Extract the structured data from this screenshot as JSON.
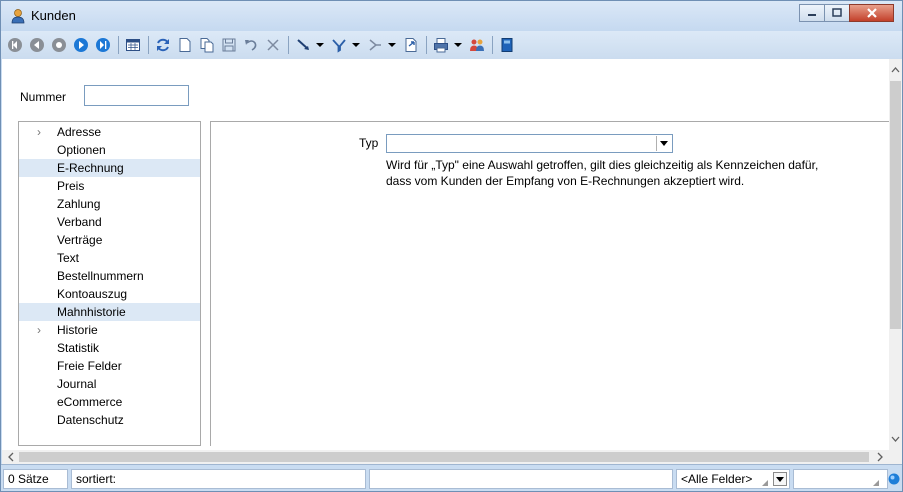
{
  "window": {
    "title": "Kunden"
  },
  "toolbar": {
    "icons": [
      "first-record-icon",
      "prev-page-icon",
      "prev-record-icon",
      "next-record-icon",
      "last-record-icon",
      "calendar-icon",
      "refresh-icon",
      "new-icon",
      "copy-icon",
      "save-icon",
      "undo-icon",
      "delete-icon",
      "tools-icon",
      "filter-icon",
      "sort-icon",
      "export-icon",
      "print-icon",
      "contacts-icon",
      "close-form-icon"
    ]
  },
  "header": {
    "nummer_label": "Nummer",
    "nummer_value": ""
  },
  "nav": {
    "items": [
      {
        "label": "Adresse",
        "expandable": true
      },
      {
        "label": "Optionen"
      },
      {
        "label": "E-Rechnung",
        "selected": true
      },
      {
        "label": "Preis"
      },
      {
        "label": "Zahlung"
      },
      {
        "label": "Verband"
      },
      {
        "label": "Verträge"
      },
      {
        "label": "Text"
      },
      {
        "label": "Bestellnummern"
      },
      {
        "label": "Kontoauszug"
      },
      {
        "label": "Mahnhistorie",
        "selected": true
      },
      {
        "label": "Historie",
        "expandable": true
      },
      {
        "label": "Statistik"
      },
      {
        "label": "Freie Felder"
      },
      {
        "label": "Journal"
      },
      {
        "label": "eCommerce"
      },
      {
        "label": "Datenschutz"
      }
    ]
  },
  "detail": {
    "typ_label": "Typ",
    "typ_value": "",
    "hint_line1": "Wird für „Typ\" eine Auswahl getroffen, gilt dies gleichzeitig als Kennzeichen dafür,",
    "hint_line2": "dass vom Kunden der Empfang von E-Rechnungen akzeptiert wird."
  },
  "status": {
    "count": "0 Sätze",
    "sort": "sortiert:",
    "field_filter": "<Alle Felder>"
  },
  "colors": {
    "chrome": "#c9dcf1",
    "selection": "#dce8f5",
    "close": "#c3402a"
  }
}
